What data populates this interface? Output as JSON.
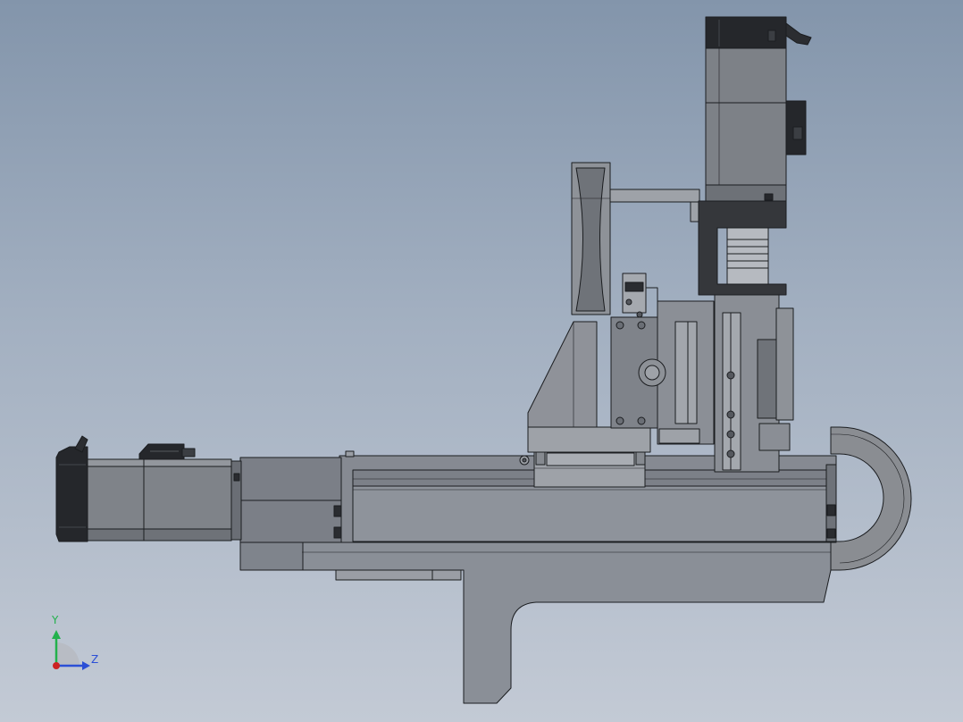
{
  "viewport": {
    "background_top": "#8395ab",
    "background_bottom": "#c3cad5"
  },
  "model": {
    "body_color": "#8a8d93",
    "dark_color": "#2a2c30",
    "edge_color": "#1b1d20"
  },
  "triad": {
    "y_label": "Y",
    "z_label": "Z",
    "y_color": "#22b14c",
    "z_color": "#2b4fd6",
    "x_color": "#cc2222"
  }
}
